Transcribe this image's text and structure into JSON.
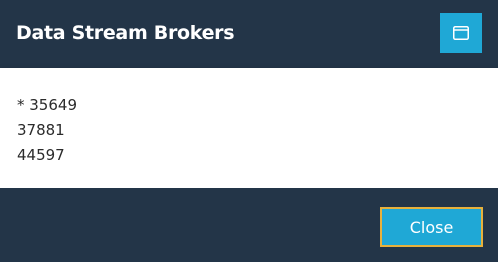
{
  "dialog": {
    "title": "Data Stream Brokers",
    "maximize_icon": "window-maximize-icon",
    "brokers": [
      "* 35649",
      "37881",
      "44597"
    ],
    "close_label": "Close"
  },
  "colors": {
    "chrome": "#233548",
    "accent": "#1fa8d6",
    "focus_border": "#e7b13c",
    "body_background": "#ffffff"
  }
}
